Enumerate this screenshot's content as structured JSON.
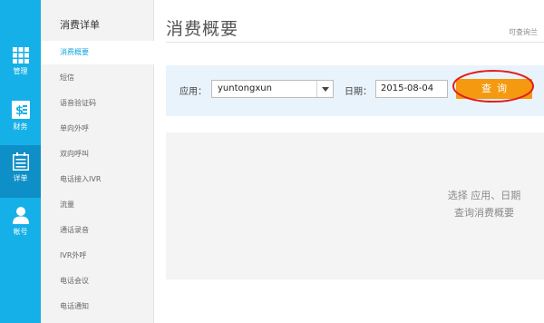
{
  "rail": {
    "items": [
      {
        "label": "管理",
        "icon": "grid-icon"
      },
      {
        "label": "财务",
        "icon": "finance-icon"
      },
      {
        "label": "详单",
        "icon": "list-icon"
      },
      {
        "label": "帐号",
        "icon": "user-icon"
      }
    ],
    "active_index": 2
  },
  "subnav": {
    "title": "消费详单",
    "items": [
      {
        "label": "消费概要"
      },
      {
        "label": "短信"
      },
      {
        "label": "语音验证码"
      },
      {
        "label": "单向外呼"
      },
      {
        "label": "双向呼叫"
      },
      {
        "label": "电话接入IVR"
      },
      {
        "label": "流量"
      },
      {
        "label": "通话录音"
      },
      {
        "label": "IVR外呼"
      },
      {
        "label": "电话会议"
      },
      {
        "label": "电话通知"
      }
    ],
    "active_index": 0
  },
  "main": {
    "title": "消费概要",
    "corner_text": "可查询兰",
    "app_label": "应用：",
    "app_value": "yuntongxun",
    "date_label": "日期：",
    "date_value": "2015-08-04",
    "query_button": "查询",
    "empty_line1": "选择 应用、日期",
    "empty_line2": "查询消费概要"
  },
  "colors": {
    "rail_bg": "#16b0e8",
    "rail_active": "#0f8fc7",
    "accent_text": "#16a6e0",
    "query_button": "#f59a10",
    "highlight_ellipse": "#e02020"
  }
}
